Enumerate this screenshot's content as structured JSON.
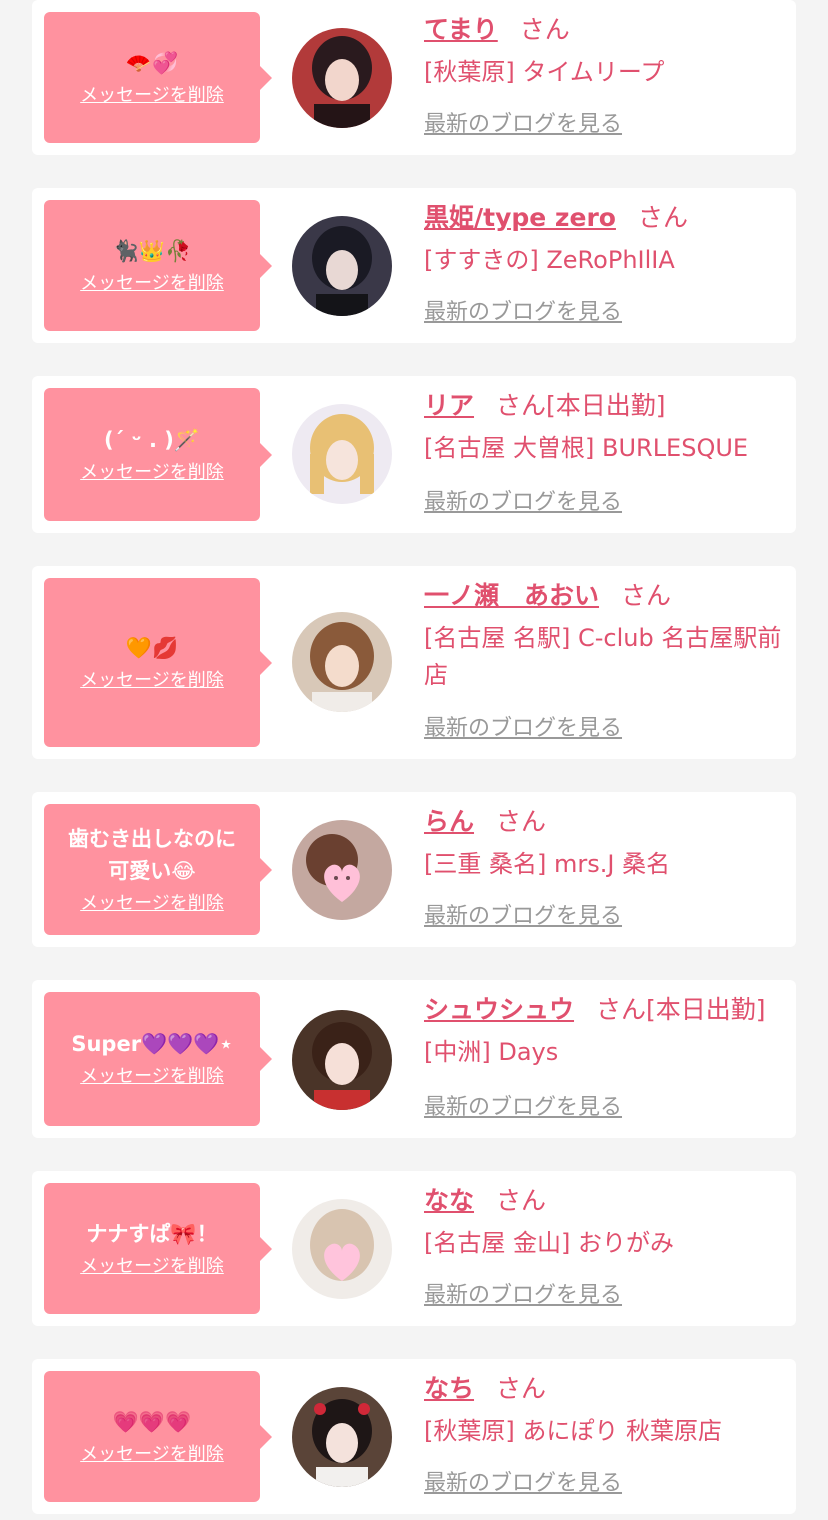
{
  "cards": [
    {
      "message": "🪭💞",
      "delete_label": "メッセージを削除",
      "name": "てまり",
      "honorific": "さん",
      "badge": "",
      "shop": "[秋葉原] タイムリープ",
      "blog_label": "最新のブログを見る",
      "avatar": "avatar-photo-temari"
    },
    {
      "message": "🐈‍⬛👑🥀",
      "delete_label": "メッセージを削除",
      "name": "黒姫/type zero",
      "honorific": "さん",
      "badge": "",
      "shop": "[すすきの] ZeRoPhIlIA",
      "blog_label": "最新のブログを見る",
      "avatar": "avatar-photo-kurohime"
    },
    {
      "message": "(ˊ ᵕ . )🪄",
      "delete_label": "メッセージを削除",
      "name": "リア",
      "honorific": "さん",
      "badge": "[本日出勤]",
      "shop": "[名古屋 大曽根] BURLESQUE",
      "blog_label": "最新のブログを見る",
      "avatar": "avatar-photo-ria"
    },
    {
      "message": "🧡💋",
      "delete_label": "メッセージを削除",
      "name": "一ノ瀬　あおい",
      "honorific": "さん",
      "badge": "",
      "shop": "[名古屋 名駅] C-club 名古屋駅前店",
      "blog_label": "最新のブログを見る",
      "avatar": "avatar-photo-ichinose"
    },
    {
      "message": "歯むき出しなのに\n可愛い😂",
      "delete_label": "メッセージを削除",
      "name": "らん",
      "honorific": "さん",
      "badge": "",
      "shop": "[三重 桑名] mrs.J 桑名",
      "blog_label": "最新のブログを見る",
      "avatar": "avatar-photo-ran"
    },
    {
      "message": "Super💜💜💜⋆",
      "delete_label": "メッセージを削除",
      "name": "シュウシュウ",
      "honorific": "さん",
      "badge": "[本日出勤]",
      "shop": "[中洲] Days",
      "blog_label": "最新のブログを見る",
      "avatar": "avatar-photo-shushu"
    },
    {
      "message": "ナナすぱ🎀！",
      "delete_label": "メッセージを削除",
      "name": "なな",
      "honorific": "さん",
      "badge": "",
      "shop": "[名古屋 金山] おりがみ",
      "blog_label": "最新のブログを見る",
      "avatar": "avatar-photo-nana"
    },
    {
      "message": "💗💗💗",
      "delete_label": "メッセージを削除",
      "name": "なち",
      "honorific": "さん",
      "badge": "",
      "shop": "[秋葉原] あにぽり 秋葉原店",
      "blog_label": "最新のブログを見る",
      "avatar": "avatar-photo-nachi"
    }
  ],
  "colors": {
    "bubble": "#ff929f",
    "name": "#e0506e",
    "blog_link": "#999999",
    "page_bg": "#f4f4f4"
  }
}
